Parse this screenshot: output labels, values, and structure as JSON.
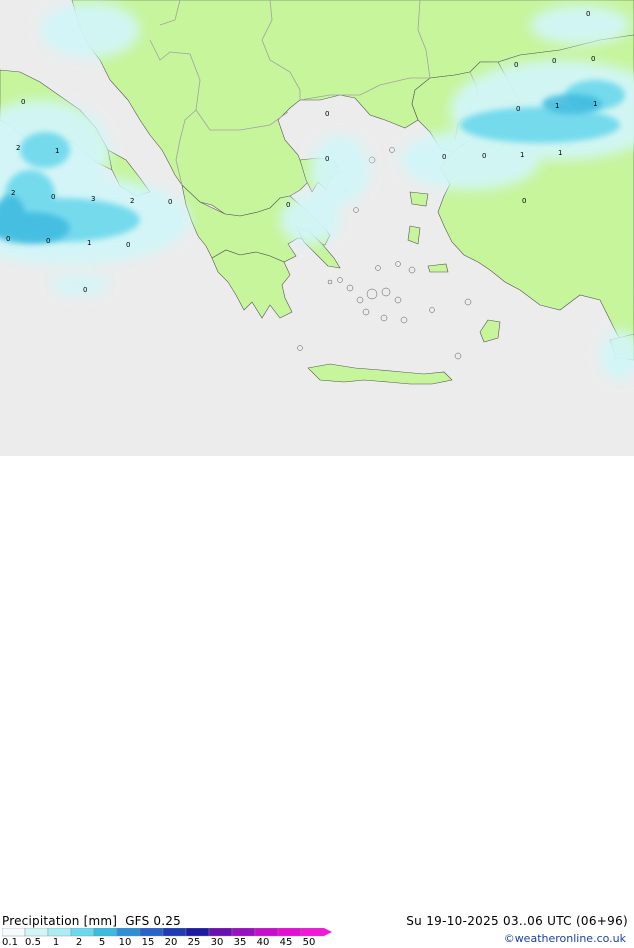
{
  "legend": {
    "title": "Precipitation [mm]",
    "model": "GFS 0.25",
    "date_text": "Su 19-10-2025 03..06 UTC (06+96)",
    "credit": "©weatheronline.co.uk",
    "ticks": [
      "0.1",
      "0.5",
      "1",
      "2",
      "5",
      "10",
      "15",
      "20",
      "25",
      "30",
      "35",
      "40",
      "45",
      "50"
    ],
    "colors": [
      "#f5fbfc",
      "#d2f6f8",
      "#aaeef4",
      "#6cd8ec",
      "#3cbadf",
      "#2f8fd6",
      "#2a63c8",
      "#203bb3",
      "#1c1ca1",
      "#6a0fb0",
      "#9a10c0",
      "#c80ecc",
      "#e60ed2",
      "#f416d8"
    ]
  },
  "colors": {
    "sea": "#ececec",
    "land": "#c6f59c",
    "border": "#a2a2a2",
    "coast": "#555555"
  },
  "map_labels": [
    "0",
    "0",
    "0",
    "0",
    "0",
    "0",
    "0",
    "1",
    "1",
    "2",
    "1",
    "0",
    "0",
    "0",
    "1",
    "1",
    "2",
    "0",
    "3",
    "2",
    "0",
    "0",
    "0",
    "0",
    "0",
    "1",
    "0",
    "0"
  ]
}
